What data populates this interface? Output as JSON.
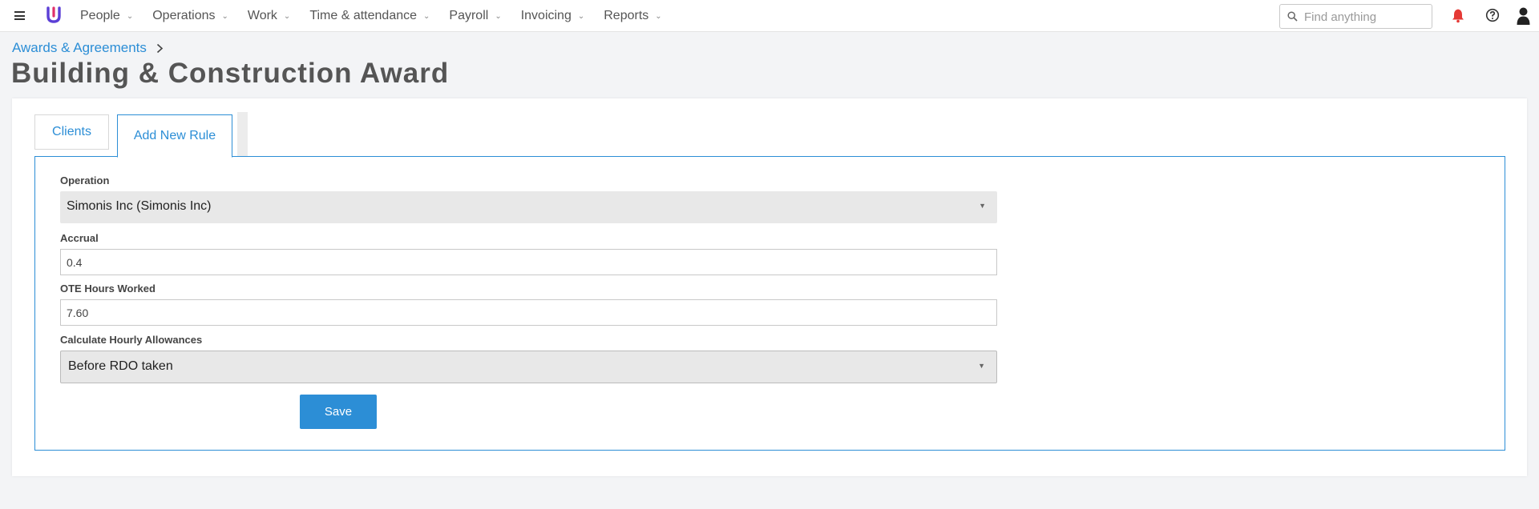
{
  "topbar": {
    "nav": [
      {
        "label": "People"
      },
      {
        "label": "Operations"
      },
      {
        "label": "Work"
      },
      {
        "label": "Time & attendance"
      },
      {
        "label": "Payroll"
      },
      {
        "label": "Invoicing"
      },
      {
        "label": "Reports"
      }
    ],
    "search_placeholder": "Find anything",
    "accent_color": "#2c8ed6",
    "notification_color": "#e53935"
  },
  "breadcrumb": {
    "label": "Awards & Agreements"
  },
  "page": {
    "title": "Building & Construction Award"
  },
  "tabs": [
    {
      "label": "Clients"
    },
    {
      "label": "Add New Rule",
      "active": true
    }
  ],
  "form": {
    "operation": {
      "label": "Operation",
      "value": "Simonis Inc (Simonis Inc)"
    },
    "accrual": {
      "label": "Accrual",
      "value": "0.4"
    },
    "ote_hours": {
      "label": "OTE Hours Worked",
      "value": "7.60"
    },
    "hourly_allowances": {
      "label": "Calculate Hourly Allowances",
      "value": "Before RDO taken"
    },
    "save_label": "Save"
  }
}
